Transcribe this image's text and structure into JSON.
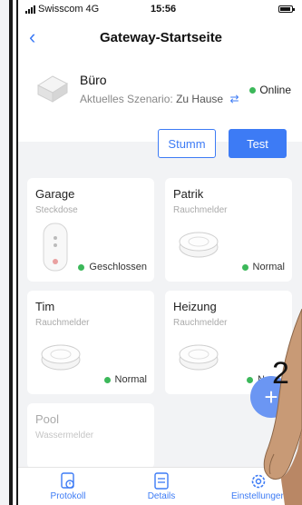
{
  "status_bar": {
    "carrier": "Swisscom",
    "network": "4G",
    "time": "15:56"
  },
  "nav": {
    "title": "Gateway-Startseite",
    "back_icon": "chevron-left-icon"
  },
  "gateway": {
    "name": "Büro",
    "scene_label": "Aktuelles Szenario:",
    "scene_value": "Zu Hause",
    "status": "Online",
    "status_color": "#3cb85a"
  },
  "actions": {
    "mute_label": "Stumm",
    "test_label": "Test"
  },
  "devices": [
    {
      "name": "Garage",
      "type": "Steckdose",
      "status": "Geschlossen"
    },
    {
      "name": "Patrik",
      "type": "Rauchmelder",
      "status": "Normal"
    },
    {
      "name": "Tim",
      "type": "Rauchmelder",
      "status": "Normal"
    },
    {
      "name": "Heizung",
      "type": "Rauchmelder",
      "status": "No"
    },
    {
      "name": "Pool",
      "type": "Wassermelder",
      "status": ""
    }
  ],
  "fab": {
    "label": "+"
  },
  "tabs": [
    {
      "label": "Protokoll",
      "icon": "clock-icon"
    },
    {
      "label": "Details",
      "icon": "document-icon"
    },
    {
      "label": "Einstellungen",
      "icon": "gear-icon"
    }
  ],
  "overlay": {
    "step_number": "2"
  },
  "colors": {
    "accent": "#3d7bf5",
    "online": "#3cb85a"
  }
}
